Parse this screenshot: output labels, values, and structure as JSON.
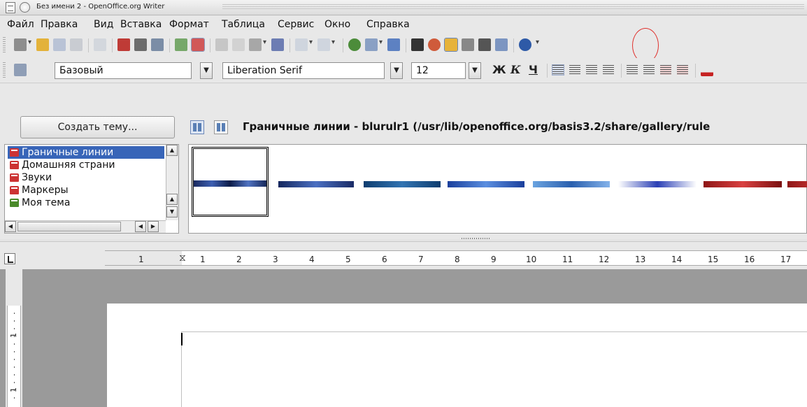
{
  "window": {
    "title": "Без имени 2 - OpenOffice.org Writer"
  },
  "menu": {
    "items": [
      "Файл",
      "Правка",
      "Вид",
      "Вставка",
      "Формат",
      "Таблица",
      "Сервис",
      "Окно",
      "Справка"
    ]
  },
  "formatting": {
    "style": "Базовый",
    "font": "Liberation Serif",
    "size": "12",
    "bold": "Ж",
    "italic": "К",
    "underline": "Ч"
  },
  "gallery": {
    "create_theme_label": "Создать тему...",
    "header": "Граничные линии - blurulr1 (/usr/lib/openoffice.org/basis3.2/share/gallery/rule",
    "themes": [
      {
        "label": "Граничные линии",
        "selected": true
      },
      {
        "label": "Домашняя страни",
        "selected": false
      },
      {
        "label": "Звуки",
        "selected": false
      },
      {
        "label": "Маркеры",
        "selected": false
      },
      {
        "label": "Моя тема",
        "selected": false
      }
    ]
  },
  "ruler": {
    "labels": [
      "1",
      "1",
      "2",
      "3",
      "4",
      "5",
      "6",
      "7",
      "8",
      "9",
      "10",
      "11",
      "12",
      "13",
      "14",
      "15",
      "16",
      "17"
    ]
  },
  "vruler": {
    "labels": [
      "1",
      "1"
    ]
  },
  "colors": {
    "selection": "#3865b8",
    "highlight_ellipse": "#e0322e"
  }
}
